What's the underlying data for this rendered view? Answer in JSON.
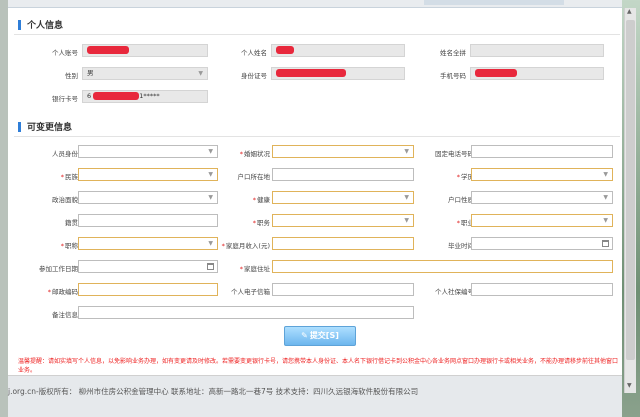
{
  "personal": {
    "title": "个人信息",
    "account_label": "个人账号",
    "name_label": "个人姓名",
    "pinyin_label": "姓名全拼",
    "gender_label": "性别",
    "gender_value": "男",
    "id_label": "身份证号",
    "phone_label": "手机号码",
    "bank_label": "银行卡号",
    "bank_prefix": "6",
    "bank_suffix": "1*****"
  },
  "editable": {
    "title": "可变更信息",
    "identity_label": "人员身份",
    "marital_label": "婚姻状况",
    "landline_label": "固定电话号码",
    "ethnic_label": "民族",
    "hukou_label": "户口所在地",
    "education_label": "学历",
    "political_label": "政治面貌",
    "health_label": "健康",
    "hukou_nature_label": "户口性质",
    "native_label": "籍贯",
    "duty_label": "职务",
    "occupation_label": "职业",
    "title_label": "职称",
    "income_label": "家庭月收入(元)",
    "graduation_label": "毕业时间",
    "work_date_label": "参加工作日期",
    "address_label": "家庭住址",
    "postcode_label": "邮政编码",
    "email_label": "个人电子信箱",
    "social_label": "个人社保编号",
    "remark_label": "备注信息"
  },
  "submit_label": "提交[S]",
  "notice": "温馨提醒：请如实填写个人信息，以免影响业务办理，如有变更请及时修改。若需要变更银行卡号，请您携带本人身份证、本人名下银行借记卡到公积金中心各业务网点窗口办理银行卡或相关业务，不能办理请移步前往其他窗口业务。",
  "footer": "j.org.cn-版权所有：  柳州市住房公积金管理中心  联系地址：高新一路北一巷7号  技术支持：四川久远银海软件股份有限公司",
  "colors": {
    "accent": "#2f7ed8",
    "required": "#e02020",
    "redaction": "#e8283c"
  }
}
